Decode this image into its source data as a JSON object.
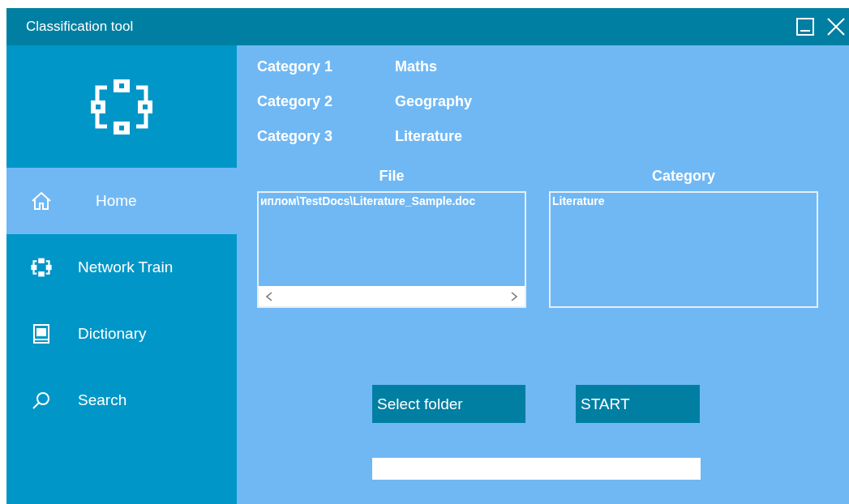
{
  "window": {
    "title": "Classification tool"
  },
  "sidebar": {
    "items": [
      {
        "label": "Home",
        "selected": true
      },
      {
        "label": "Network Train",
        "selected": false
      },
      {
        "label": "Dictionary",
        "selected": false
      },
      {
        "label": "Search",
        "selected": false
      }
    ]
  },
  "categories": [
    {
      "label": "Category 1",
      "value": "Maths"
    },
    {
      "label": "Category 2",
      "value": "Geography"
    },
    {
      "label": "Category 3",
      "value": "Literature"
    }
  ],
  "file_list": {
    "heading": "File",
    "items": [
      "иплом\\TestDocs\\Literature_Sample.doc"
    ]
  },
  "category_list": {
    "heading": "Category",
    "items": [
      "Literature"
    ]
  },
  "buttons": [
    "Select folder",
    "START"
  ]
}
